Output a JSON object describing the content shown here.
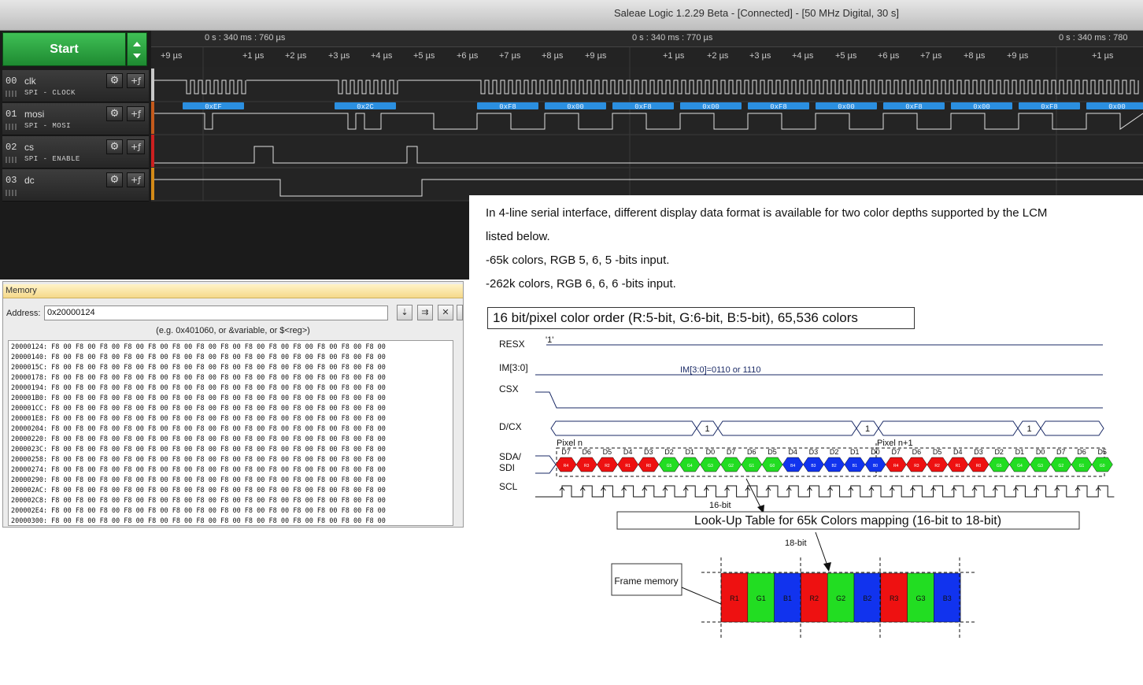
{
  "window": {
    "title": "Saleae Logic 1.2.29 Beta - [Connected] - [50 MHz Digital, 30 s]"
  },
  "logic": {
    "start_label": "Start",
    "time_markers": [
      "0 s : 340 ms : 760 µs",
      "0 s : 340 ms : 770 µs",
      "0 s : 340 ms : 780"
    ],
    "ticks": [
      "+9 µs",
      "+1 µs",
      "+2 µs",
      "+3 µs",
      "+4 µs",
      "+5 µs",
      "+6 µs",
      "+7 µs",
      "+8 µs",
      "+9 µs",
      "+1 µs",
      "+2 µs",
      "+3 µs",
      "+4 µs",
      "+5 µs",
      "+6 µs",
      "+7 µs",
      "+8 µs",
      "+9 µs",
      "+1 µs"
    ],
    "channels": [
      {
        "num": "00",
        "name": "clk",
        "analyzer": "SPI - CLOCK",
        "color": "#c8c8c8"
      },
      {
        "num": "01",
        "name": "mosi",
        "analyzer": "SPI - MOSI",
        "color": "#c45a1c"
      },
      {
        "num": "02",
        "name": "cs",
        "analyzer": "SPI - ENABLE",
        "color": "#cc2020"
      },
      {
        "num": "03",
        "name": "dc",
        "analyzer": "",
        "color": "#d38a18"
      }
    ],
    "mosi_bytes": [
      "0xEF",
      "0x2C",
      "0xF8",
      "0x00",
      "0xF8",
      "0x00",
      "0xF8",
      "0x00",
      "0xF8",
      "0x00",
      "0xF8",
      "0x00"
    ]
  },
  "memory": {
    "tab_label": "Memory",
    "address_label": "Address:",
    "address_value": "0x20000124",
    "hint": "(e.g. 0x401060, or &variable, or $<reg>)",
    "row_bytes": "F8 00 F8 00 F8 00 F8 00 F8 00 F8 00 F8 00 F8 00 F8 00 F8 00 F8 00 F8 00 F8 00 F8 00",
    "rows": [
      "20000124:",
      "20000140:",
      "2000015C:",
      "20000178:",
      "20000194:",
      "200001B0:",
      "200001CC:",
      "200001E8:",
      "20000204:",
      "20000220:",
      "2000023C:",
      "20000258:",
      "20000274:",
      "20000290:",
      "200002AC:",
      "200002C8:",
      "200002E4:",
      "20000300:"
    ]
  },
  "doc": {
    "para": [
      "In 4-line serial interface, different display data format is available for two color depths supported by the LCM",
      "listed below.",
      "-65k colors, RGB 5, 6, 5 -bits input.",
      "-262k colors, RGB 6, 6, 6 -bits input."
    ],
    "diagram_title": "16 bit/pixel color order (R:5-bit, G:6-bit, B:5-bit), 65,536 colors",
    "signals": [
      "RESX",
      "IM[3:0]",
      "CSX",
      "D/CX",
      "SDA/",
      "SDI",
      "SCL"
    ],
    "resx_value": "'1'",
    "im_value": "IM[3:0]=0110 or 1110",
    "dcx_value": "1",
    "pixel_n": "Pixel n",
    "pixel_n1": "Pixel n+1",
    "bits": [
      "D7",
      "D6",
      "D5",
      "D4",
      "D3",
      "D2",
      "D1",
      "D0",
      "D7",
      "D6",
      "D5",
      "D4",
      "D3",
      "D2",
      "D1",
      "D0",
      "D7",
      "D6",
      "D5",
      "D4",
      "D3",
      "D2",
      "D1",
      "D0",
      "D7",
      "D6",
      "D5"
    ],
    "bit_colors": [
      "R",
      "R",
      "R",
      "R",
      "R",
      "G",
      "G",
      "G",
      "G",
      "G",
      "G",
      "B",
      "B",
      "B",
      "B",
      "B",
      "R",
      "R",
      "R",
      "R",
      "R",
      "G",
      "G",
      "G",
      "G",
      "G",
      "G"
    ],
    "cell_labels": [
      "R4",
      "R3",
      "R2",
      "R1",
      "R0",
      "G5",
      "G4",
      "G3",
      "G2",
      "G1",
      "G0",
      "B4",
      "B3",
      "B2",
      "B1",
      "B0",
      "R4",
      "R3",
      "R2",
      "R1",
      "R0",
      "G5",
      "G4",
      "G3",
      "G2",
      "G1",
      "G0"
    ],
    "label_16bit": "16-bit",
    "label_18bit": "18-bit",
    "lut_label": "Look-Up Table for 65k Colors mapping (16-bit to 18-bit)",
    "frame_memory": "Frame memory",
    "frame_cells": [
      "R1",
      "G1",
      "B1",
      "R2",
      "G2",
      "B2",
      "R3",
      "G3",
      "B3"
    ],
    "palette": {
      "R": "#ee1111",
      "G": "#22dd22",
      "B": "#1133ee"
    }
  }
}
